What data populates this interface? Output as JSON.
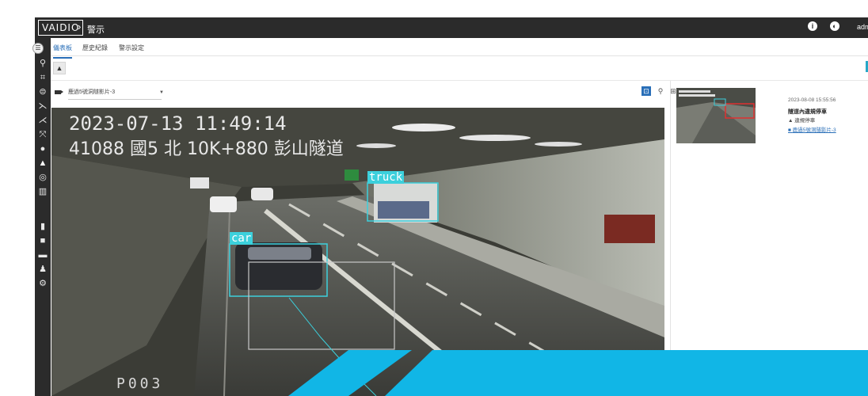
{
  "app": {
    "logo": "VAIDIO",
    "breadcrumb_sep": "›",
    "page_title": "警示",
    "user": "adm"
  },
  "top_icons": {
    "info": "info-icon",
    "globe": "globe-icon"
  },
  "sidebar": {
    "items": [
      {
        "icon": "search-icon"
      },
      {
        "icon": "face-scan-icon"
      },
      {
        "icon": "vehicle-icon"
      },
      {
        "icon": "person-walk-icon"
      },
      {
        "icon": "person-run-icon"
      },
      {
        "icon": "person-fall-icon"
      },
      {
        "icon": "alert-circle-icon"
      },
      {
        "icon": "bell-icon"
      },
      {
        "icon": "target-icon"
      },
      {
        "icon": "chart-icon"
      },
      {
        "icon": "document-icon"
      },
      {
        "icon": "camera-icon"
      },
      {
        "icon": "device-icon"
      },
      {
        "icon": "user-icon"
      },
      {
        "icon": "settings-icon"
      }
    ],
    "active_index": 7
  },
  "tabs": [
    {
      "label": "儀表板"
    },
    {
      "label": "歷史紀錄"
    },
    {
      "label": "警示設定"
    }
  ],
  "camera": {
    "selected": "鹿過5號洞隧影片-3"
  },
  "video": {
    "timestamp": "2023-07-13 11:49:14",
    "location": "41088 國5 北 10K+880 彭山隧道",
    "label_truck": "truck",
    "label_car": "car",
    "code": "P003"
  },
  "alert": {
    "time": "2023-08-08 15:55:56",
    "rule": "隧道內違規停車",
    "level": "違規停車",
    "camera": "鹿過5號洞隧影片-3"
  },
  "colors": {
    "accent": "#2a6fb8",
    "topbar": "#2b2b2b",
    "detect_box": "#3cd0dc",
    "deco": "#11b6e6"
  }
}
